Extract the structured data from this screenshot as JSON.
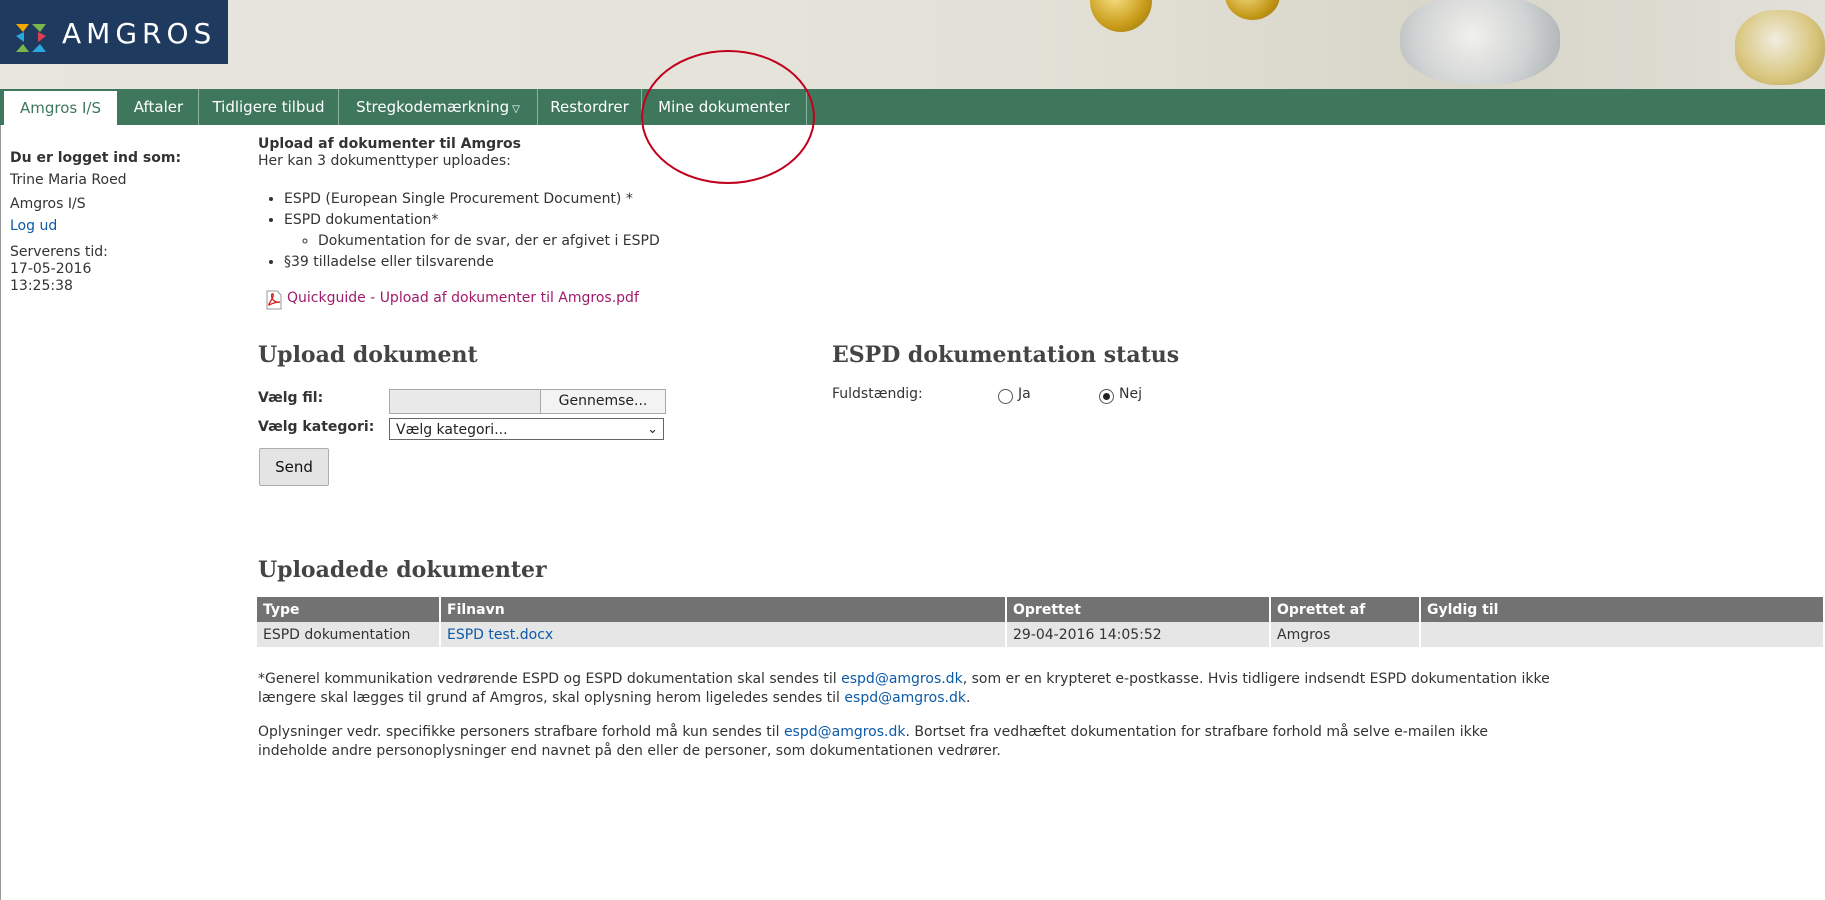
{
  "header": {
    "logo_text": "AMGROS"
  },
  "nav": {
    "items": [
      {
        "label": "Amgros I/S",
        "active": true
      },
      {
        "label": "Aftaler"
      },
      {
        "label": "Tidligere tilbud"
      },
      {
        "label": "Stregkodemærkning",
        "has_dropdown": true
      },
      {
        "label": "Restordrer"
      },
      {
        "label": "Mine dokumenter"
      }
    ]
  },
  "sidebar": {
    "logged_in_label": "Du er logget ind som:",
    "user_name": "Trine Maria Roed",
    "organization": "Amgros I/S",
    "logout_link": "Log ud",
    "server_time_label": "Serverens tid:",
    "server_date": "17-05-2016",
    "server_clock": "13:25:38"
  },
  "upload_intro": {
    "title": "Upload af dokumenter til Amgros",
    "subtitle": "Her kan 3 dokumenttyper uploades:",
    "list": [
      "ESPD (European Single Procurement Document) *",
      "ESPD dokumentation*",
      "§39 tilladelse eller tilsvarende"
    ],
    "sub_item": "Dokumentation for de svar, der er afgivet i ESPD",
    "quickguide_link": "Quickguide - Upload af dokumenter til Amgros.pdf"
  },
  "upload_form": {
    "heading": "Upload dokument",
    "file_label": "Vælg fil:",
    "browse_button": "Gennemse...",
    "category_label": "Vælg kategori:",
    "category_value": "Vælg kategori...",
    "send_button": "Send"
  },
  "espd_status": {
    "heading": "ESPD dokumentation status",
    "label": "Fuldstændig:",
    "option_yes": "Ja",
    "option_no": "Nej",
    "selected": "Nej"
  },
  "uploaded": {
    "heading": "Uploadede dokumenter",
    "columns": [
      "Type",
      "Filnavn",
      "Oprettet",
      "Oprettet af",
      "Gyldig til"
    ],
    "rows": [
      {
        "type": "ESPD dokumentation",
        "filename": "ESPD test.docx",
        "created": "29-04-2016 14:05:52",
        "created_by": "Amgros",
        "valid_to": ""
      }
    ]
  },
  "notes": {
    "n1_a": "*Generel kommunikation vedrørende ESPD og ESPD dokumentation skal sendes til ",
    "email": "espd@amgros.dk",
    "n1_b": ", som er en krypteret e-postkasse. Hvis tidligere indsendt ESPD dokumentation ikke",
    "n1_c": "længere skal lægges til grund af Amgros, skal oplysning herom ligeledes sendes til ",
    "n1_d": ".",
    "n2_a": "Oplysninger vedr. specifikke personers strafbare forhold må kun sendes til ",
    "n2_b": ". Bortset fra vedhæftet dokumentation for strafbare forhold må selve e-mailen ikke",
    "n2_c": "indeholde andre personoplysninger end navnet på den eller de personer, som dokumentationen vedrører."
  },
  "colors": {
    "nav_green": "#3f775d",
    "logo_blue": "#1f3a5f",
    "table_header": "#727272",
    "link_blue": "#0d5aa7",
    "link_magenta": "#a01a6b"
  }
}
